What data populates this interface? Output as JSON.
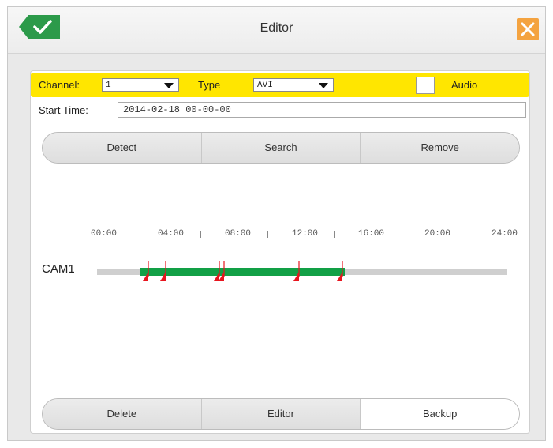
{
  "window": {
    "title": "Editor"
  },
  "filter": {
    "channel_label": "Channel:",
    "channel_value": "1",
    "type_label": "Type",
    "type_value": "AVI",
    "audio_label": "Audio",
    "audio_checked": false
  },
  "start_time": {
    "label": "Start Time:",
    "value": "2014-02-18   00-00-00"
  },
  "actions_top": [
    "Detect",
    "Search",
    "Remove"
  ],
  "timeline": {
    "camera": "CAM1",
    "ticks": [
      "00:00",
      "04:00",
      "08:00",
      "12:00",
      "16:00",
      "20:00",
      "24:00"
    ],
    "recording_range": [
      "02:30",
      "14:30"
    ],
    "events": [
      "03:00",
      "04:00",
      "07:10",
      "07:25",
      "11:50",
      "14:20"
    ]
  },
  "actions_bottom": [
    "Delete",
    "Editor",
    "Backup"
  ],
  "active_bottom": "Backup",
  "colors": {
    "highlight": "#ffe600",
    "recording": "#12a046",
    "event_marker": "#e8141e",
    "close": "#f4a340",
    "ok": "#2c9a4a"
  }
}
